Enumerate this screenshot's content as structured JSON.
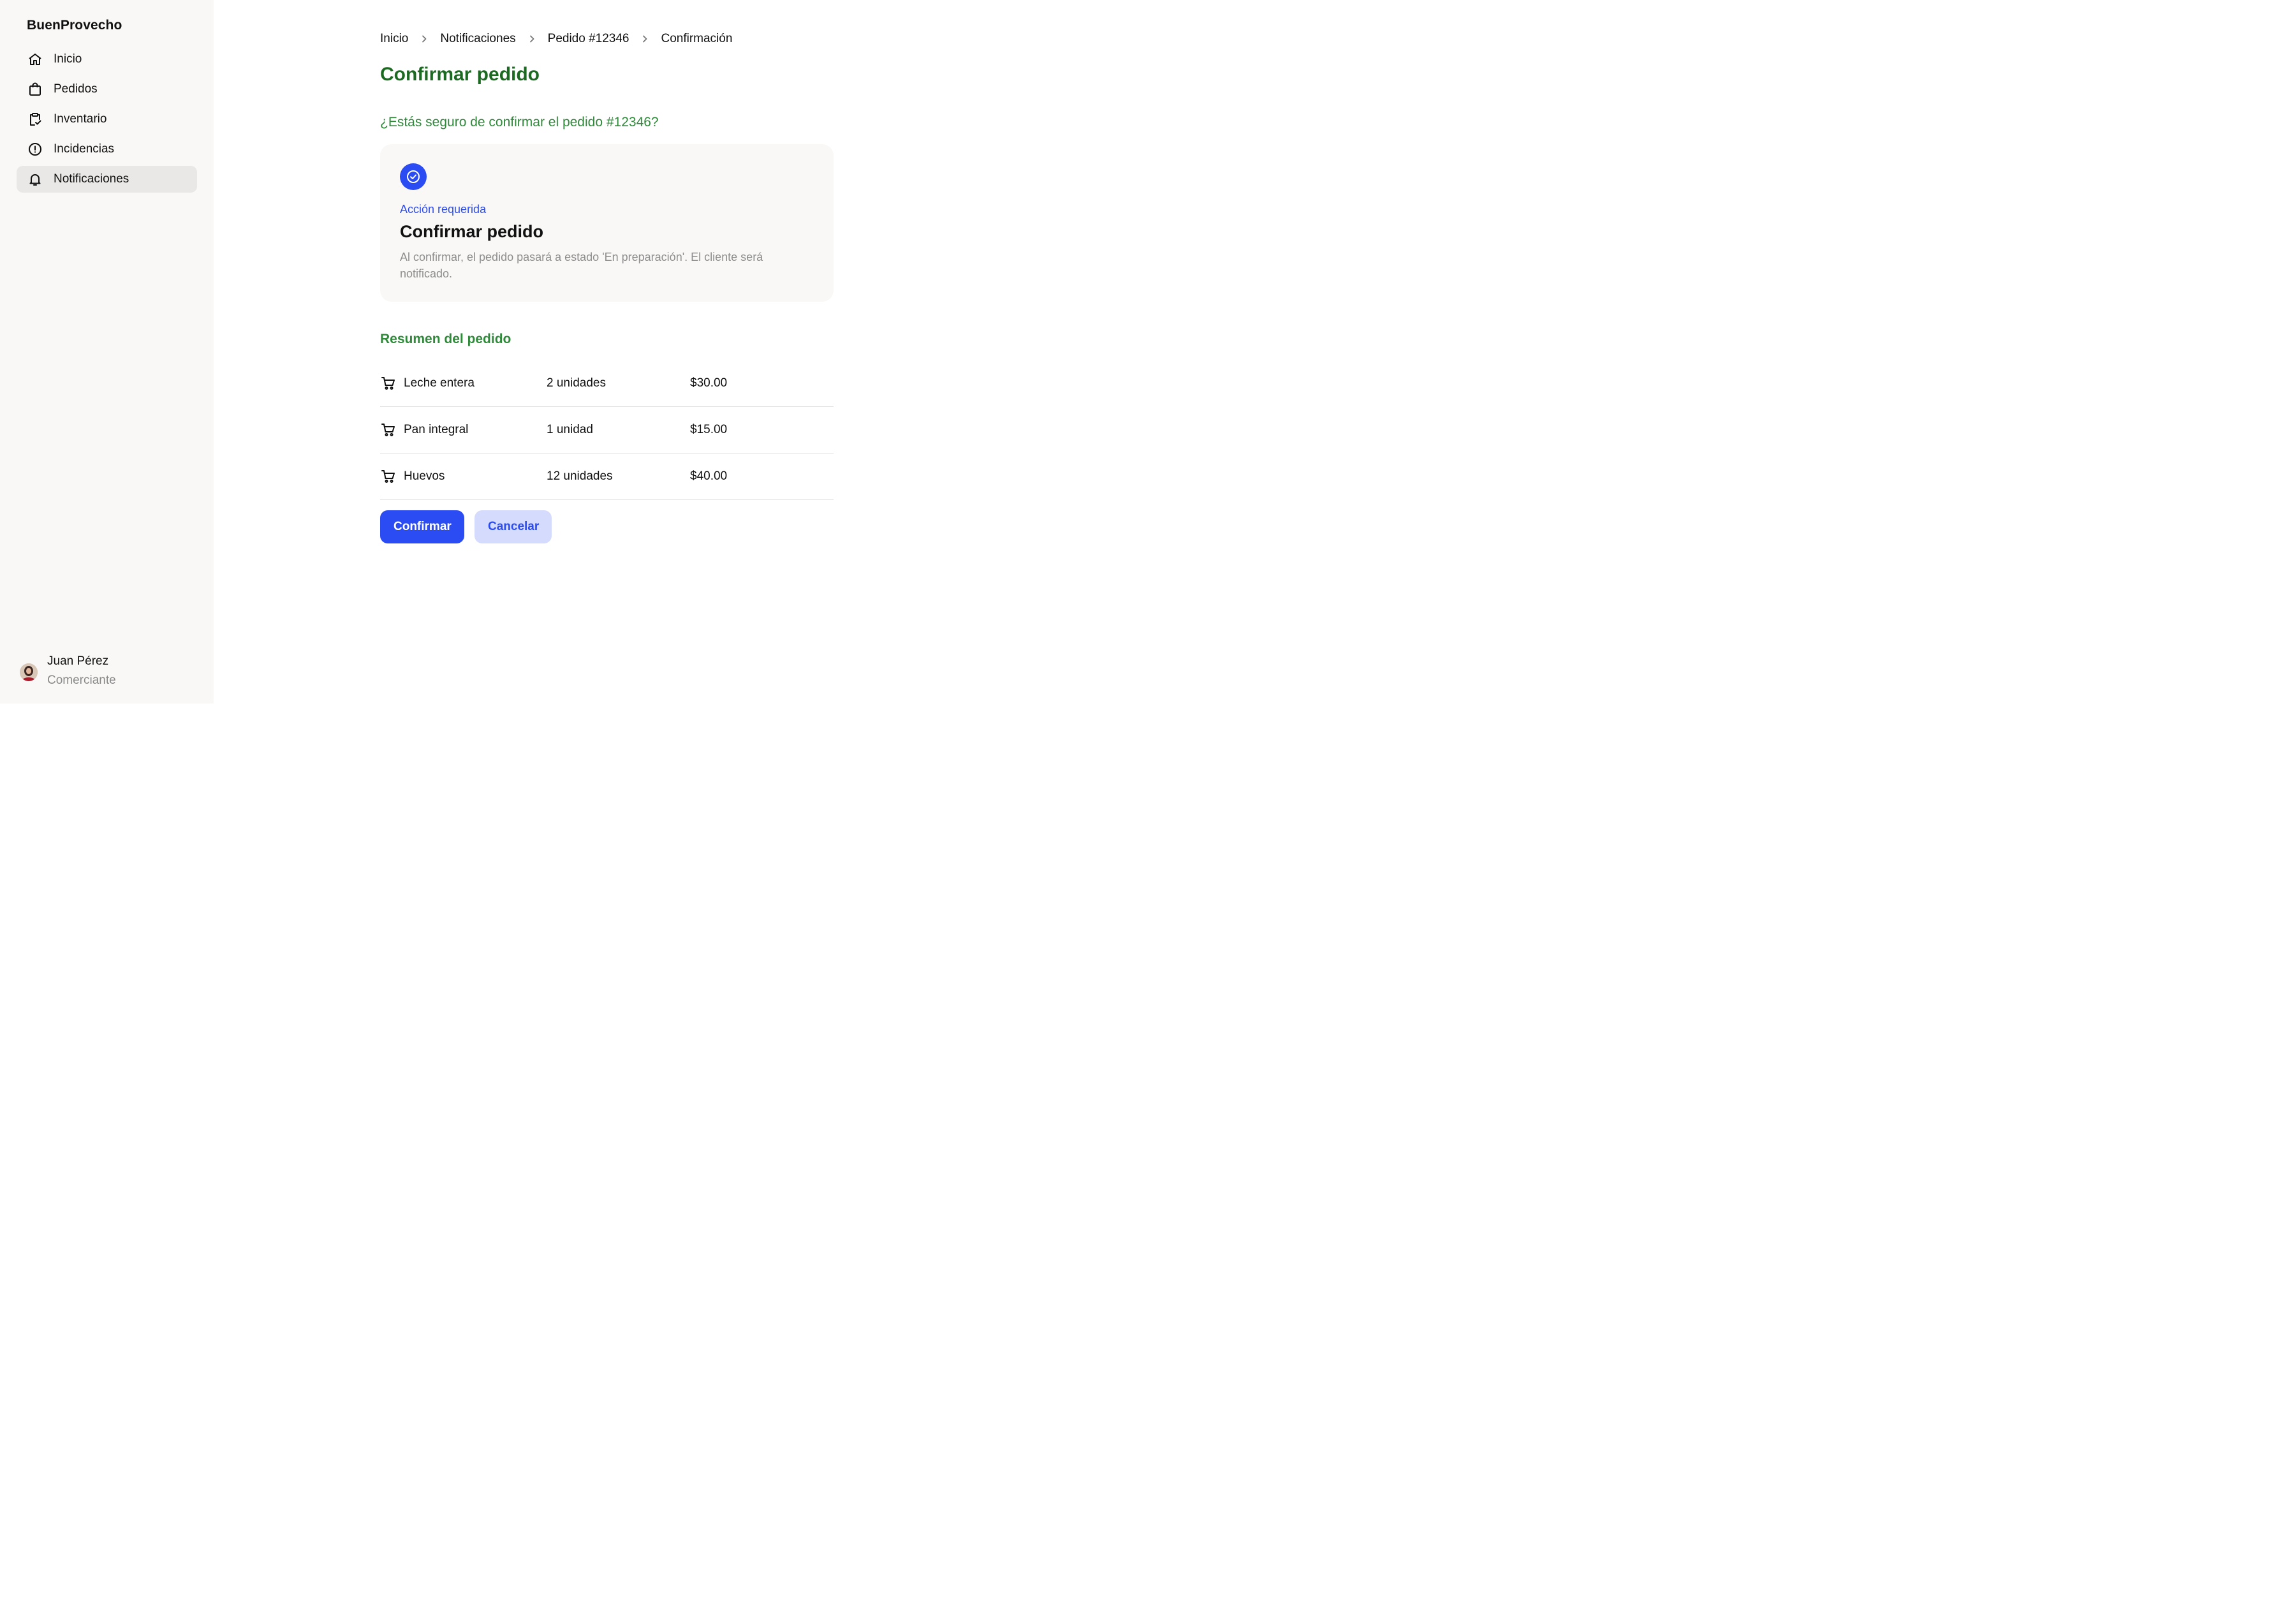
{
  "sidebar": {
    "brand": "BuenProvecho",
    "items": [
      {
        "label": "Inicio",
        "icon": "home-icon"
      },
      {
        "label": "Pedidos",
        "icon": "shopping-bag-icon"
      },
      {
        "label": "Inventario",
        "icon": "clipboard-check-icon"
      },
      {
        "label": "Incidencias",
        "icon": "alert-circle-icon"
      },
      {
        "label": "Notificaciones",
        "icon": "bell-icon",
        "active": true
      }
    ],
    "user": {
      "name": "Juan Pérez",
      "role": "Comerciante"
    }
  },
  "breadcrumb": [
    "Inicio",
    "Notificaciones",
    "Pedido #12346",
    "Confirmación"
  ],
  "page": {
    "title": "Confirmar pedido",
    "question": "¿Estás seguro de confirmar el pedido #12346?"
  },
  "card": {
    "tag": "Acción requerida",
    "title": "Confirmar pedido",
    "description": "Al confirmar, el pedido pasará a estado 'En preparación'. El cliente será notificado."
  },
  "summary": {
    "title": "Resumen del pedido",
    "items": [
      {
        "name": "Leche entera",
        "qty": "2 unidades",
        "price": "$30.00"
      },
      {
        "name": "Pan integral",
        "qty": "1 unidad",
        "price": "$15.00"
      },
      {
        "name": "Huevos",
        "qty": "12 unidades",
        "price": "$40.00"
      }
    ]
  },
  "actions": {
    "confirm": "Confirmar",
    "cancel": "Cancelar"
  },
  "colors": {
    "accent": "#2b4cf2",
    "title_green": "#1c6a22",
    "subtitle_green": "#2f8a3a",
    "sidebar_bg": "#f9f8f6"
  }
}
